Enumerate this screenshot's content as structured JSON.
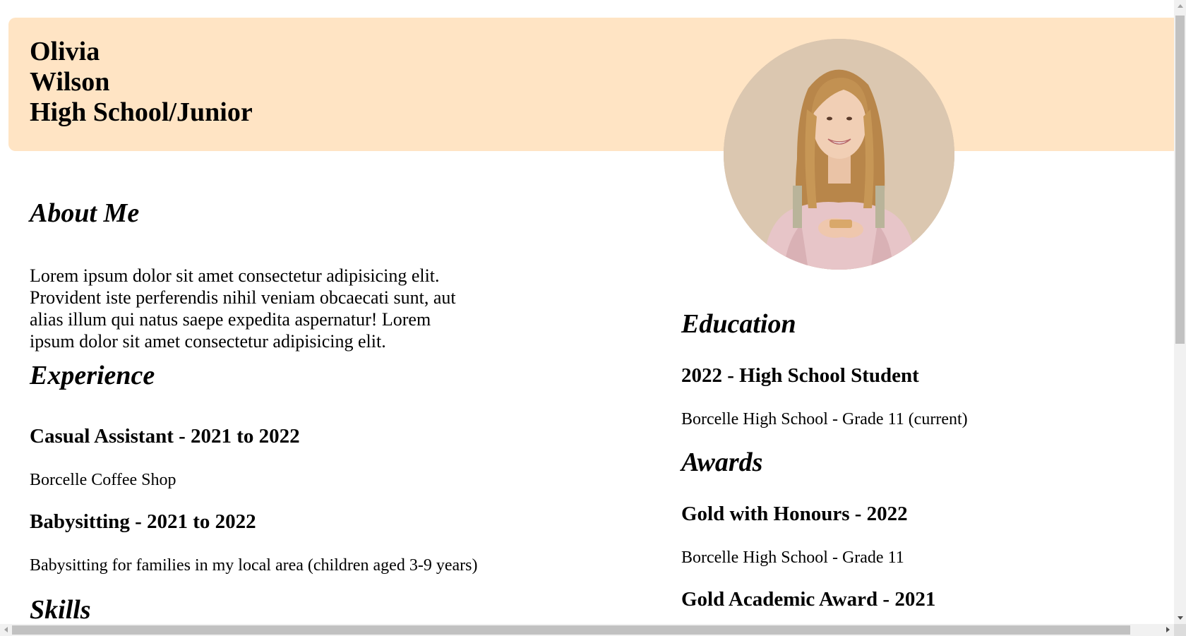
{
  "header": {
    "first_name": "Olivia",
    "last_name": "Wilson",
    "level": "High School/Junior",
    "photo_icon": "profile-photo",
    "band_color": "#ffe4c4"
  },
  "about": {
    "heading": "About Me",
    "line1": "Lorem ipsum dolor sit amet consectetur adipisicing elit.",
    "line2": "Provident iste perferendis nihil veniam obcaecati sunt, aut",
    "line3": "alias illum qui natus saepe expedita aspernatur! Lorem",
    "line4": "ipsum dolor sit amet consectetur adipisicing elit."
  },
  "experience": {
    "heading": "Experience",
    "items": [
      {
        "title": "Casual Assistant - 2021 to 2022",
        "detail": "Borcelle Coffee Shop"
      },
      {
        "title": "Babysitting - 2021 to 2022",
        "detail": "Babysitting for families in my local area (children aged 3-9 years)"
      }
    ]
  },
  "skills": {
    "heading": "Skills"
  },
  "education": {
    "heading": "Education",
    "items": [
      {
        "title": "2022 - High School Student",
        "detail": "Borcelle High School - Grade 11 (current)"
      }
    ]
  },
  "awards": {
    "heading": "Awards",
    "items": [
      {
        "title": "Gold with Honours - 2022",
        "detail": "Borcelle High School - Grade 11"
      },
      {
        "title": "Gold Academic Award - 2021"
      }
    ]
  }
}
